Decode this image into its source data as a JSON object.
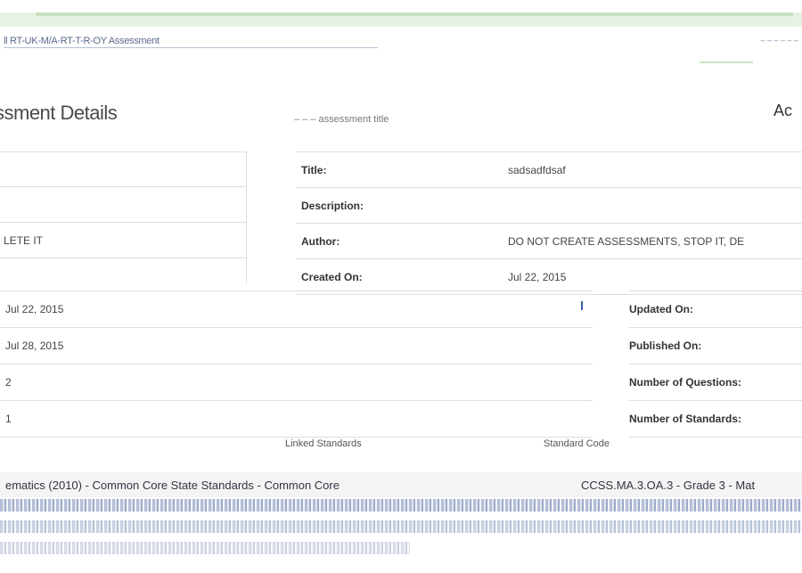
{
  "header": {
    "breadcrumb": "ll  RT-UK-M/A-RT-T-R-OY Assessment",
    "right_link": "– – – – – –"
  },
  "heading": {
    "title": "ssment Details",
    "subtitle": "– – –  assessment title",
    "right": "Ac"
  },
  "details": {
    "left_values": [
      "",
      "",
      "LETE IT"
    ],
    "rows": [
      {
        "label": "Title:",
        "value": "sadsadfdsaf"
      },
      {
        "label": "Description:",
        "value": ""
      },
      {
        "label": "Author:",
        "value": "DO NOT CREATE ASSESSMENTS, STOP IT, DE"
      },
      {
        "label": "Created On:",
        "value": "Jul 22, 2015"
      }
    ]
  },
  "lower": {
    "values": [
      "Jul 22, 2015",
      "Jul 28, 2015",
      "2",
      "1"
    ],
    "labels": [
      "Updated On:",
      "Published On:",
      "Number of Questions:",
      "Number of Standards:"
    ]
  },
  "standards": {
    "head_a": "Linked Standards",
    "head_b": "Standard Code",
    "row_a": "ematics (2010) - Common Core State Standards - Common Core",
    "row_b": "CCSS.MA.3.OA.3 - Grade 3 - Mat"
  }
}
